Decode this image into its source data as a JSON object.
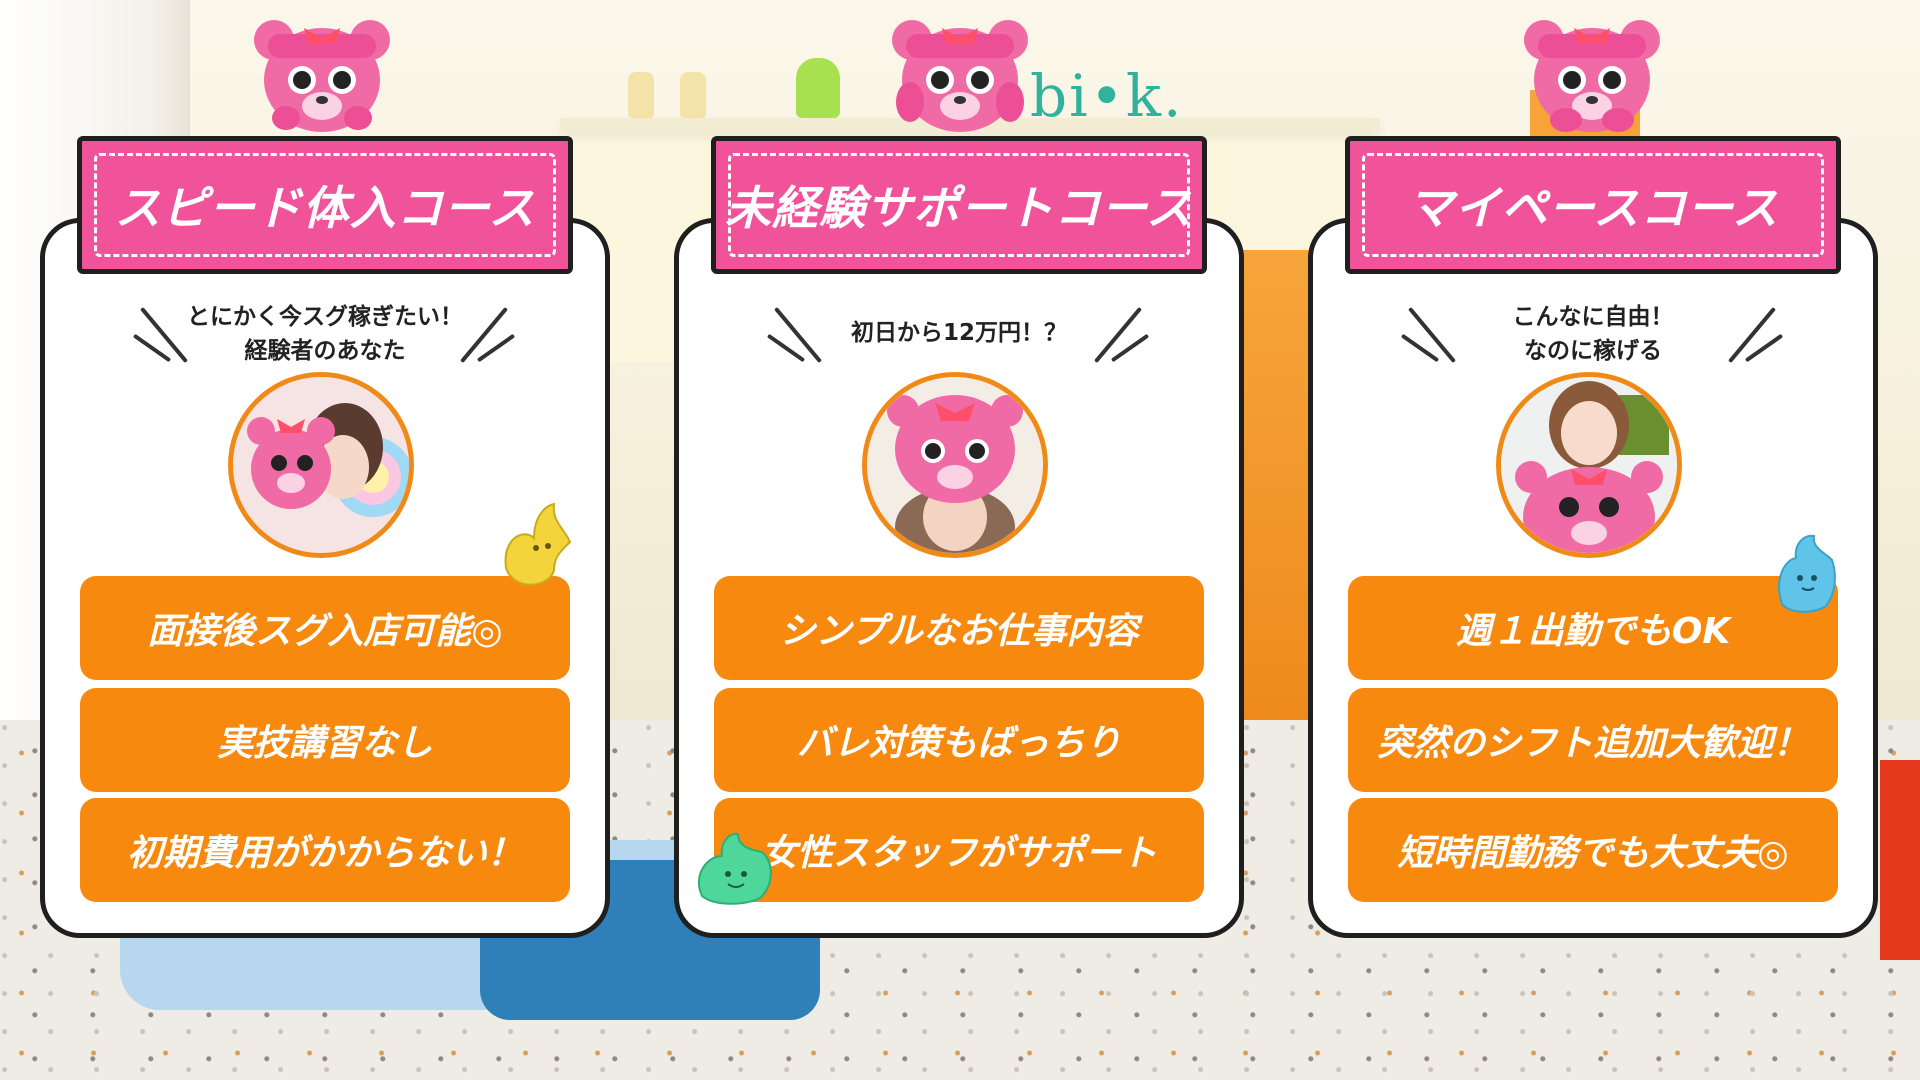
{
  "courses": [
    {
      "title": "スピード体入コース",
      "tagline": "とにかく今スグ稼ぎたい！\n経験者のあなた",
      "features": [
        "面接後スグ入店可能◎",
        "実技講習なし",
        "初期費用がかからない！"
      ]
    },
    {
      "title": "未経験サポートコース",
      "tagline": "初日から12万円！？",
      "features": [
        "シンプルなお仕事内容",
        "バレ対策もばっちり",
        "女性スタッフがサポート"
      ]
    },
    {
      "title": "マイペースコース",
      "tagline": "こんなに自由！\nなのに稼げる",
      "features": [
        "週１出勤でもOK",
        "突然のシフト追加大歓迎！",
        "短時間勤務でも大丈夫◎"
      ]
    }
  ],
  "colors": {
    "title_pink": "#f1539b",
    "feature_orange": "#f7890f",
    "photo_ring": "#f08a16",
    "outline": "#1f1f1f"
  },
  "icons": {
    "mascot": "pink-bear-mascot-icon",
    "figures": [
      "yellow-figure-icon",
      "green-figure-icon",
      "blue-figure-icon"
    ]
  }
}
